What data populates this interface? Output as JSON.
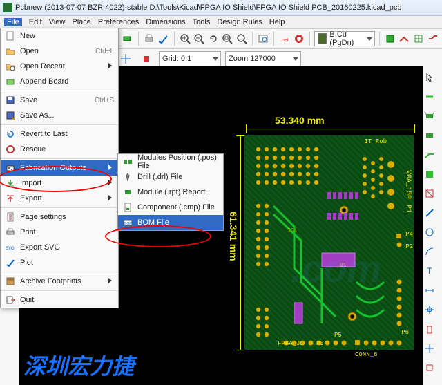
{
  "title": "Pcbnew (2013-07-07 BZR 4022)-stable D:\\Tools\\Kicad\\FPGA IO Shield\\FPGA IO Shield PCB_20160225.kicad_pcb",
  "menubar": [
    "File",
    "Edit",
    "View",
    "Place",
    "Preferences",
    "Dimensions",
    "Tools",
    "Design Rules",
    "Help"
  ],
  "toolbar2": {
    "grid_label": "Grid: 0.1",
    "zoom_label": "Zoom 127000"
  },
  "layer": "B.Cu (PgDn)",
  "filemenu": {
    "new": "New",
    "open": "Open",
    "open_kb": "Ctrl+L",
    "open_recent": "Open Recent",
    "append": "Append Board",
    "save": "Save",
    "save_kb": "Ctrl+S",
    "save_as": "Save As...",
    "revert": "Revert to Last",
    "rescue": "Rescue",
    "fabrication": "Fabrication Outputs",
    "import": "Import",
    "export": "Export",
    "page": "Page settings",
    "print": "Print",
    "svg": "Export SVG",
    "plot": "Plot",
    "archive": "Archive Footprints",
    "quit": "Quit"
  },
  "submenu": {
    "modules": "Modules Position (.pos) File",
    "drill": "Drill (.drl) File",
    "module_rpt": "Module (.rpt) Report",
    "cmp": "Component (.cmp) File",
    "bom": "BOM File"
  },
  "dims": {
    "w": "53.340  mm",
    "h": "61.341  mm"
  },
  "silks": {
    "vga": "VGA_15P",
    "p1": "P1",
    "p4": "P4",
    "p2": "P2",
    "p5": "P5",
    "p3": "P3",
    "p6": "P6",
    "fpga": "FPGA_J1",
    "conn": "CONN_6",
    "u1": "U1",
    "it": "IT Rob",
    "ic": "IC1"
  },
  "watermark": "www",
  "watermark2": ".com",
  "cn_text": "深圳宏力捷"
}
